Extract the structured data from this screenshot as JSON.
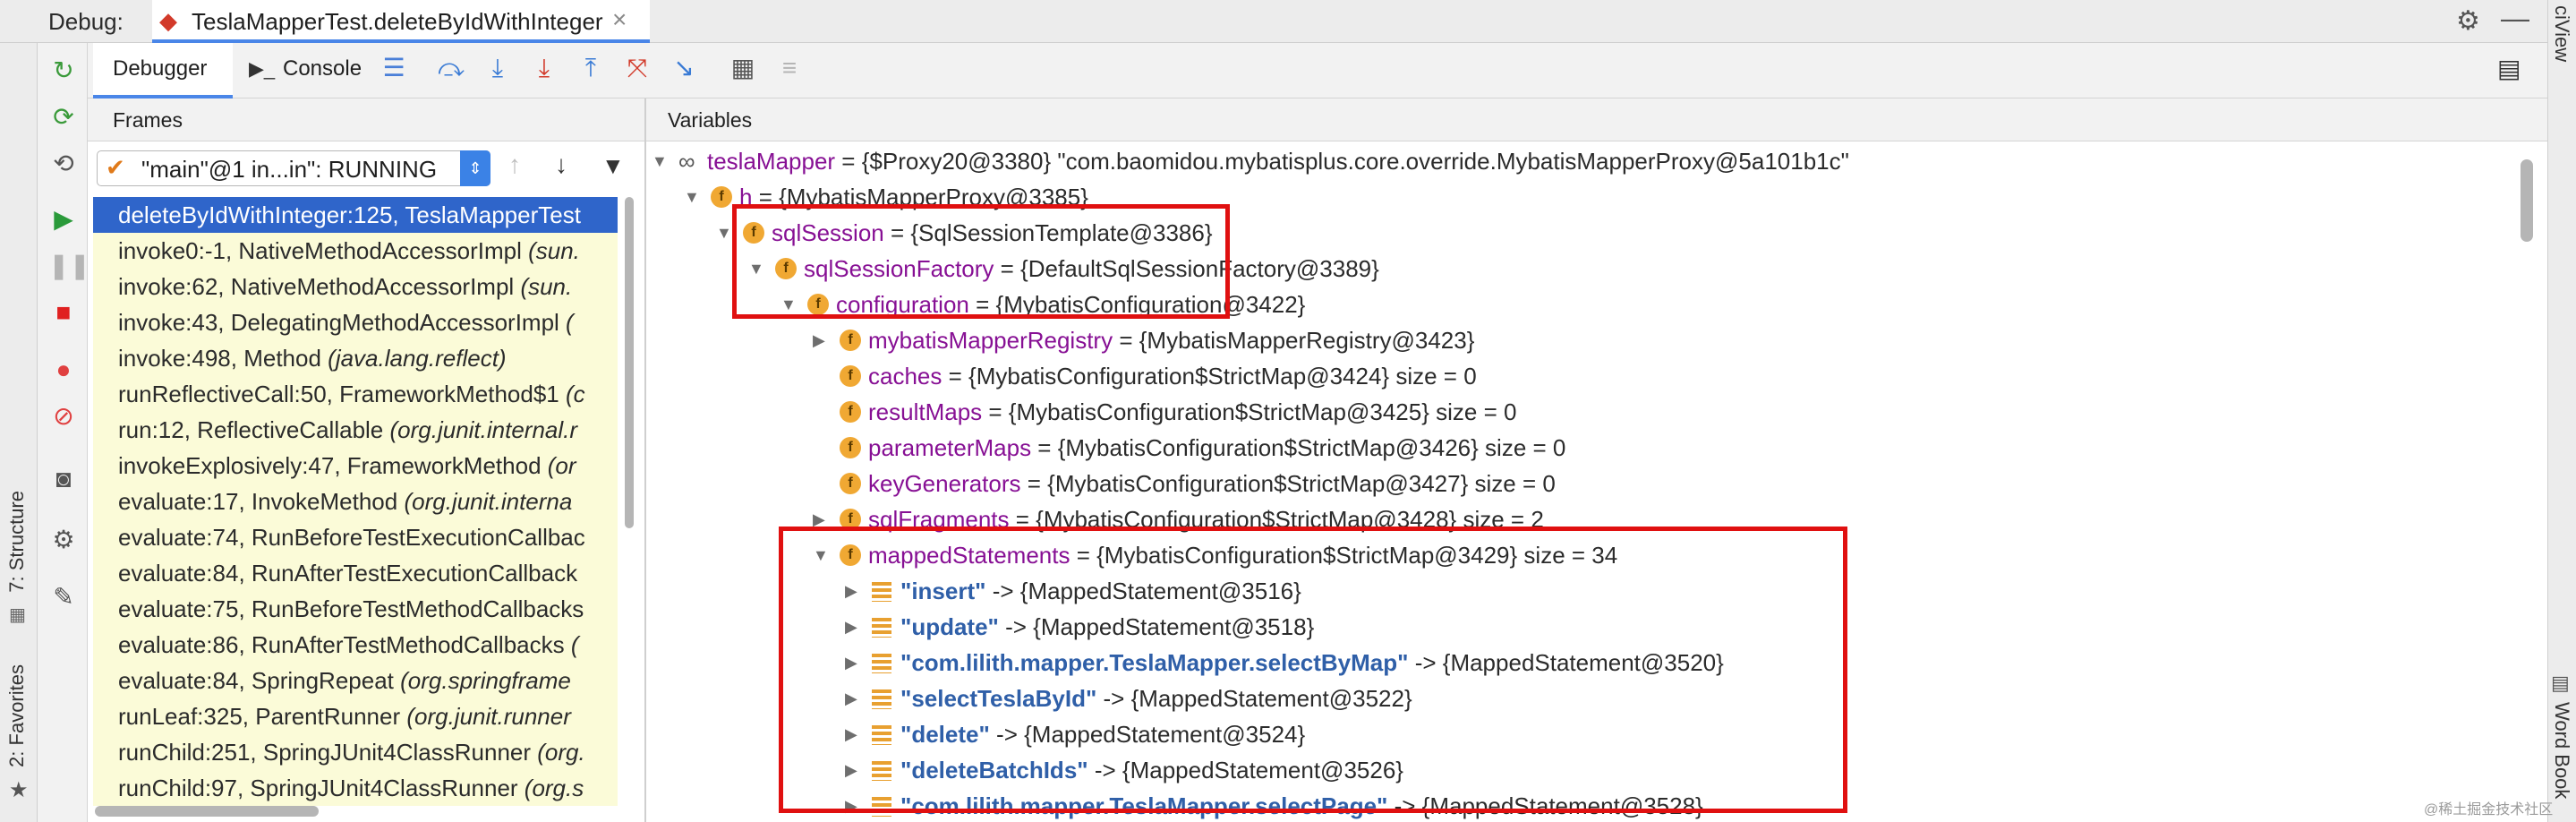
{
  "header": {
    "debug_label": "Debug:",
    "session_tab": "TeslaMapperTest.deleteByIdWithInteger",
    "close_glyph": "×",
    "right_top_text": "ciView",
    "right_bottom_text": "Word Book"
  },
  "left_strip": {
    "structure": "7: Structure",
    "favorites": "2: Favorites"
  },
  "tabs": {
    "debugger": "Debugger",
    "console": "Console"
  },
  "frames": {
    "title": "Frames",
    "thread": "\"main\"@1 in...in\": RUNNING",
    "items": [
      {
        "method": "deleteByIdWithInteger:125, TeslaMapperTest",
        "cls": ""
      },
      {
        "method": "invoke0:-1, NativeMethodAccessorImpl ",
        "cls": "(sun."
      },
      {
        "method": "invoke:62, NativeMethodAccessorImpl ",
        "cls": "(sun."
      },
      {
        "method": "invoke:43, DelegatingMethodAccessorImpl ",
        "cls": "("
      },
      {
        "method": "invoke:498, Method ",
        "cls": "(java.lang.reflect)"
      },
      {
        "method": "runReflectiveCall:50, FrameworkMethod$1 ",
        "cls": "(c"
      },
      {
        "method": "run:12, ReflectiveCallable ",
        "cls": "(org.junit.internal.r"
      },
      {
        "method": "invokeExplosively:47, FrameworkMethod ",
        "cls": "(or"
      },
      {
        "method": "evaluate:17, InvokeMethod ",
        "cls": "(org.junit.interna"
      },
      {
        "method": "evaluate:74, RunBeforeTestExecutionCallbac",
        "cls": ""
      },
      {
        "method": "evaluate:84, RunAfterTestExecutionCallback",
        "cls": ""
      },
      {
        "method": "evaluate:75, RunBeforeTestMethodCallbacks",
        "cls": ""
      },
      {
        "method": "evaluate:86, RunAfterTestMethodCallbacks ",
        "cls": "("
      },
      {
        "method": "evaluate:84, SpringRepeat ",
        "cls": "(org.springframe"
      },
      {
        "method": "runLeaf:325, ParentRunner ",
        "cls": "(org.junit.runner"
      },
      {
        "method": "runChild:251, SpringJUnit4ClassRunner ",
        "cls": "(org."
      },
      {
        "method": "runChild:97, SpringJUnit4ClassRunner ",
        "cls": "(org.s"
      }
    ]
  },
  "variables": {
    "title": "Variables",
    "rows": [
      {
        "name": "teslaMapper",
        "value": " = {$Proxy20@3380} \"com.baomidou.mybatisplus.core.override.MybatisMapperProxy@5a101b1c\"",
        "size": ""
      },
      {
        "name": "h",
        "value": " = {MybatisMapperProxy@3385}",
        "size": ""
      },
      {
        "name": "sqlSession",
        "value": " = {SqlSessionTemplate@3386}",
        "size": ""
      },
      {
        "name": "sqlSessionFactory",
        "value": " = {DefaultSqlSessionFactory@3389}",
        "size": ""
      },
      {
        "name": "configuration",
        "value": " = {MybatisConfiguration@3422}",
        "size": ""
      },
      {
        "name": "mybatisMapperRegistry",
        "value": " = {MybatisMapperRegistry@3423}",
        "size": ""
      },
      {
        "name": "caches",
        "value": " = {MybatisConfiguration$StrictMap@3424}",
        "size": "  size = 0"
      },
      {
        "name": "resultMaps",
        "value": " = {MybatisConfiguration$StrictMap@3425}",
        "size": "  size = 0"
      },
      {
        "name": "parameterMaps",
        "value": " = {MybatisConfiguration$StrictMap@3426}",
        "size": "  size = 0"
      },
      {
        "name": "keyGenerators",
        "value": " = {MybatisConfiguration$StrictMap@3427}",
        "size": "  size = 0"
      },
      {
        "name": "sqlFragments",
        "value": " = {MybatisConfiguration$StrictMap@3428}",
        "size": "  size = 2"
      },
      {
        "name": "mappedStatements",
        "value": " = {MybatisConfiguration$StrictMap@3429}",
        "size": "  size = 34"
      }
    ],
    "entries": [
      {
        "key": "\"insert\"",
        "value": " -> {MappedStatement@3516}"
      },
      {
        "key": "\"update\"",
        "value": " -> {MappedStatement@3518}"
      },
      {
        "key": "\"com.lilith.mapper.TeslaMapper.selectByMap\"",
        "value": " -> {MappedStatement@3520}"
      },
      {
        "key": "\"selectTeslaById\"",
        "value": " -> {MappedStatement@3522}"
      },
      {
        "key": "\"delete\"",
        "value": " -> {MappedStatement@3524}"
      },
      {
        "key": "\"deleteBatchIds\"",
        "value": " -> {MappedStatement@3526}"
      },
      {
        "key": "\"com.lilith.mapper.TeslaMapper.selectPage\"",
        "value": " -> {MappedStatement@3528}"
      }
    ]
  },
  "watermark": "@稀土掘金技术社区",
  "colors": {
    "selection": "#2f65ca",
    "frames_bg": "#fbfbd8",
    "highlight_box": "#e01010",
    "field_icon": "#f0a833"
  }
}
